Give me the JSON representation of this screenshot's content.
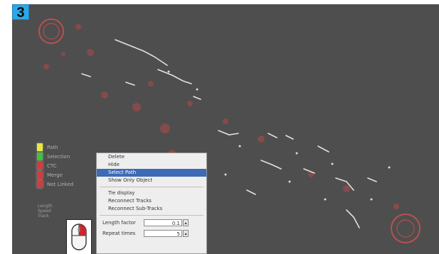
{
  "step_badge": "3",
  "legend": {
    "items": [
      {
        "label": "Path",
        "color": "#e8e845"
      },
      {
        "label": "Selection",
        "color": "#3ec23e"
      },
      {
        "label": "CTC",
        "color": "#d23c3c"
      },
      {
        "label": "Merge",
        "color": "#d23c3c"
      },
      {
        "label": "Not Linked",
        "color": "#d23c3c"
      }
    ]
  },
  "stats": {
    "rows": [
      "Length",
      "Speed",
      "Track"
    ]
  },
  "context_menu": {
    "items": [
      {
        "label": "Delete",
        "active": false
      },
      {
        "label": "Hide",
        "active": false
      },
      {
        "label": "Select Path",
        "active": true
      },
      {
        "label": "Show Only Object",
        "active": false
      }
    ],
    "items_group2": [
      {
        "label": "Tie display",
        "active": false
      },
      {
        "label": "Reconnect Tracks",
        "active": false
      },
      {
        "label": "Reconnect Sub-Tracks",
        "active": false
      }
    ],
    "fields": [
      {
        "label": "Length factor",
        "value": "0.1"
      },
      {
        "label": "Repeat times",
        "value": "5"
      }
    ]
  },
  "icons": {
    "mouse": "mouse-right-click-icon"
  },
  "colors": {
    "canvas": "#4e4e4e",
    "badge": "#2aa8e8",
    "menu_highlight": "#3d6bb5",
    "circle_marker": "#d75050"
  }
}
